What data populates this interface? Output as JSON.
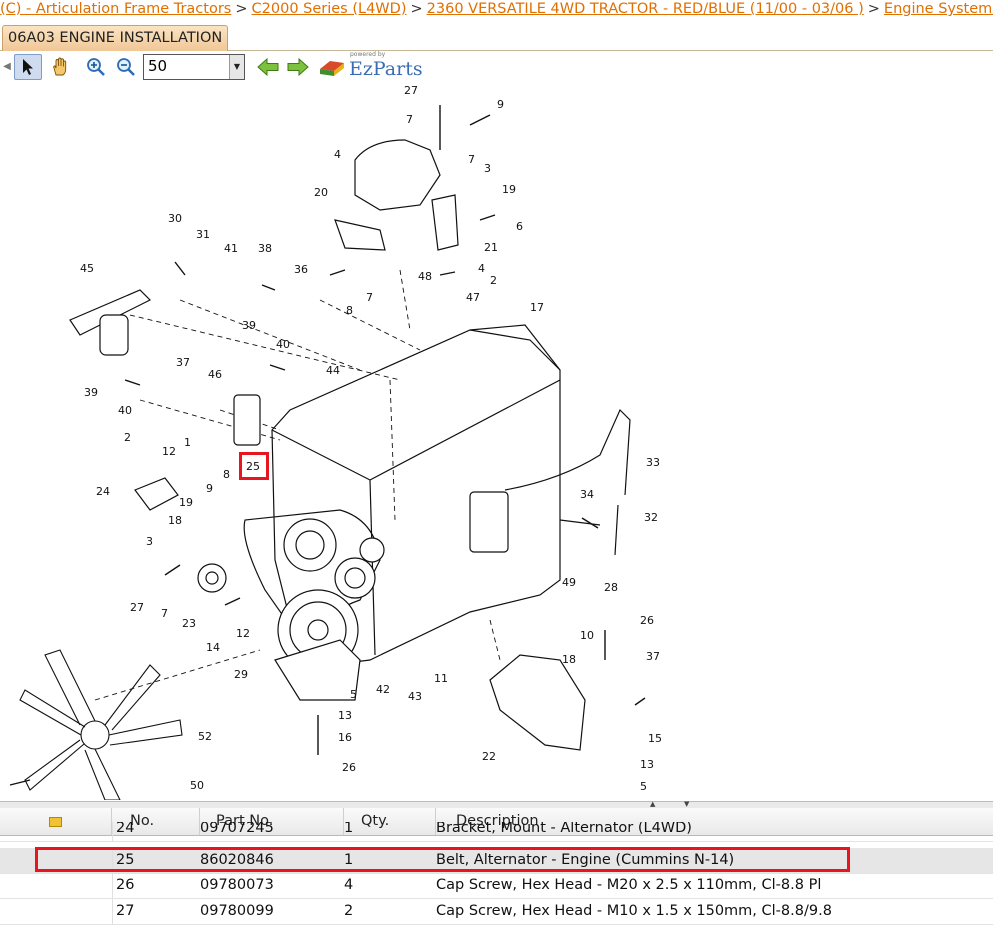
{
  "breadcrumb": {
    "items": [
      "(C) - Articulation Frame Tractors",
      "C2000 Series (L4WD)",
      "2360 VERSATILE 4WD TRACTOR - RED/BLUE (11/00 - 03/06 )",
      "Engine Systems -"
    ]
  },
  "tab": {
    "label": "06A03 ENGINE INSTALLATION"
  },
  "toolbar": {
    "zoom_value": "50",
    "logo_powered": "powered by",
    "logo_text": "EzParts",
    "icons": [
      "pointer-icon",
      "hand-icon",
      "zoom-in-icon",
      "zoom-out-icon",
      "arrow-left-icon",
      "arrow-right-icon",
      "ezparts-logo-icon"
    ]
  },
  "diagram": {
    "callouts": [
      "27",
      "9",
      "7",
      "4",
      "7",
      "3",
      "20",
      "19",
      "6",
      "21",
      "4",
      "2",
      "30",
      "31",
      "41",
      "38",
      "36",
      "7",
      "8",
      "48",
      "47",
      "45",
      "17",
      "39",
      "40",
      "44",
      "37",
      "46",
      "39",
      "40",
      "2",
      "12",
      "1",
      "8",
      "25",
      "33",
      "24",
      "9",
      "19",
      "18",
      "34",
      "32",
      "3",
      "28",
      "26",
      "27",
      "7",
      "23",
      "12",
      "14",
      "29",
      "10",
      "18",
      "37",
      "5",
      "42",
      "43",
      "11",
      "52",
      "13",
      "16",
      "26",
      "22",
      "15",
      "13",
      "5",
      "50"
    ],
    "highlighted_callout": "25"
  },
  "parts_table": {
    "columns": [
      "No.",
      "Part No.",
      "Qty.",
      "Description"
    ],
    "rows": [
      {
        "no": "24",
        "part": "09707245",
        "qty": "1",
        "desc": "Bracket, Mount - Alternator (L4WD)"
      },
      {
        "no": "25",
        "part": "86020846",
        "qty": "1",
        "desc": "Belt, Alternator - Engine (Cummins N-14)"
      },
      {
        "no": "26",
        "part": "09780073",
        "qty": "4",
        "desc": "Cap Screw, Hex Head - M20 x 2.5 x 110mm, Cl-8.8 Pl"
      },
      {
        "no": "27",
        "part": "09780099",
        "qty": "2",
        "desc": "Cap Screw, Hex Head - M10 x 1.5 x 150mm, Cl-8.8/9.8"
      }
    ],
    "selected_row": 1
  },
  "colors": {
    "link": "#e07000",
    "highlight": "#e8141e",
    "tab_bg": "#f0c796",
    "selected_row": "#e6e6e6"
  }
}
